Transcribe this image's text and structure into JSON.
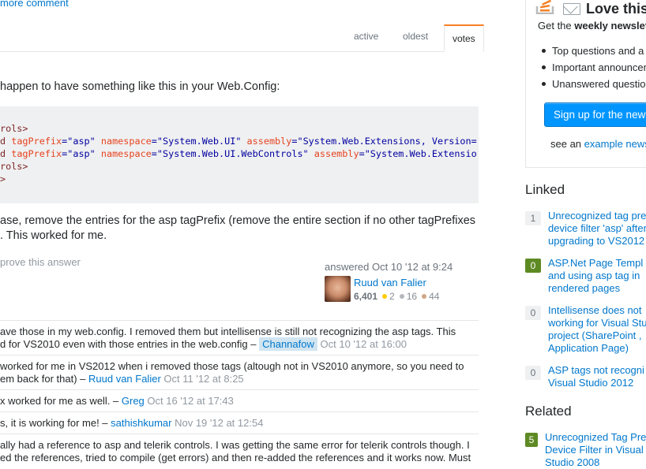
{
  "more_comment": "more comment",
  "tabs": [
    {
      "label": "active"
    },
    {
      "label": "oldest"
    },
    {
      "label": "votes"
    }
  ],
  "answer": {
    "intro": "happen to have something like this in your Web.Config:",
    "code_lines": [
      {
        "c1": "rols>"
      },
      {
        "c0": "d",
        "c1": " tagPrefix",
        "c2": "=\"asp\"",
        "c3": " namespace",
        "c4": "=\"System.Web.UI\"",
        "c5": " assembly",
        "c6": "=\"System.Web.Extensions, Version="
      },
      {
        "c0": "d",
        "c1": " tagPrefix",
        "c2": "=\"asp\"",
        "c3": " namespace",
        "c4": "=\"System.Web.UI.WebControls\"",
        "c5": " assembly",
        "c6": "=\"System.Web.Extensio"
      },
      {
        "c1": "rols>"
      },
      {
        "c1": ">"
      }
    ],
    "body_line1": "ase, remove the entries for the asp tagPrefix (remove the entire section if no other tagPrefixes",
    "body_line2": ". This worked for me.",
    "improve_link": "prove this answer",
    "answered": "answered Oct 10 '12 at 9:24",
    "user": {
      "name": "Ruud van Falier",
      "rep": "6,401",
      "gold": "2",
      "silver": "16",
      "bronze": "44"
    }
  },
  "comments": [
    {
      "lines": [
        {
          "text": "ave those in my web.config. I removed them but intellisense is still not recognizing the asp tags. This"
        },
        {
          "text": "d for VS2010 even with those entries in the web.config – ",
          "user": "Channafow",
          "op": true,
          "time": "Oct 10 '12 at 16:00"
        }
      ]
    },
    {
      "lines": [
        {
          "text": "worked for me in VS2012 when i removed those tags (altough not in VS2010 anymore, so you need to"
        },
        {
          "text": "em back for that) – ",
          "user": "Ruud van Falier",
          "time": "Oct 11 '12 at 8:25"
        }
      ]
    },
    {
      "lines": [
        {
          "text": "x worked for me as well. – ",
          "user": "Greg",
          "time": "Oct 16 '12 at 17:43"
        }
      ]
    },
    {
      "lines": [
        {
          "text": "s, it is working for me! – ",
          "user": "sathishkumar",
          "time": "Nov 19 '12 at 12:54"
        }
      ]
    },
    {
      "lines": [
        {
          "text": "ally had a reference to asp and telerik controls. I was getting the same error for telerik controls though. I"
        },
        {
          "text": "ed the references, tried to compile (get errors) and then re-added the references and it works now. Must"
        }
      ]
    }
  ],
  "sidebar": {
    "newsletter": {
      "title": "Love this",
      "sub_prefix": "Get the ",
      "sub_bold": "weekly newslet",
      "items": [
        "Top questions and a",
        "Important announcem",
        "Unanswered question"
      ],
      "button": "Sign up for the news",
      "see_prefix": "see an ",
      "see_link": "example news"
    },
    "linked_title": "Linked",
    "linked": [
      {
        "score": "1",
        "accepted": false,
        "lines": [
          "Unrecognized tag pre",
          "device filter 'asp' after",
          "upgrading to VS2012"
        ]
      },
      {
        "score": "0",
        "accepted": true,
        "lines": [
          "ASP.Net Page Templ",
          "and using asp tag in",
          "rendered pages"
        ]
      },
      {
        "score": "0",
        "accepted": false,
        "lines": [
          "Intellisense does not",
          "working for Visual Stu",
          "project (SharePoint ,",
          "Application Page)"
        ]
      },
      {
        "score": "0",
        "accepted": false,
        "lines": [
          "ASP tags not recogni",
          "Visual Studio 2012"
        ]
      }
    ],
    "related_title": "Related",
    "related": [
      {
        "score": "5",
        "accepted": true,
        "lines": [
          "Unrecognized Tag Pre",
          "Device Filter in Visual",
          "Studio 2008"
        ]
      }
    ]
  },
  "colors": {
    "link": "#0077cc",
    "tab_accent": "#f48024",
    "button": "#0095ff",
    "accepted": "#5e8a23",
    "gold": "#ffcc01",
    "silver": "#b4b8bc",
    "bronze": "#d1a684"
  }
}
